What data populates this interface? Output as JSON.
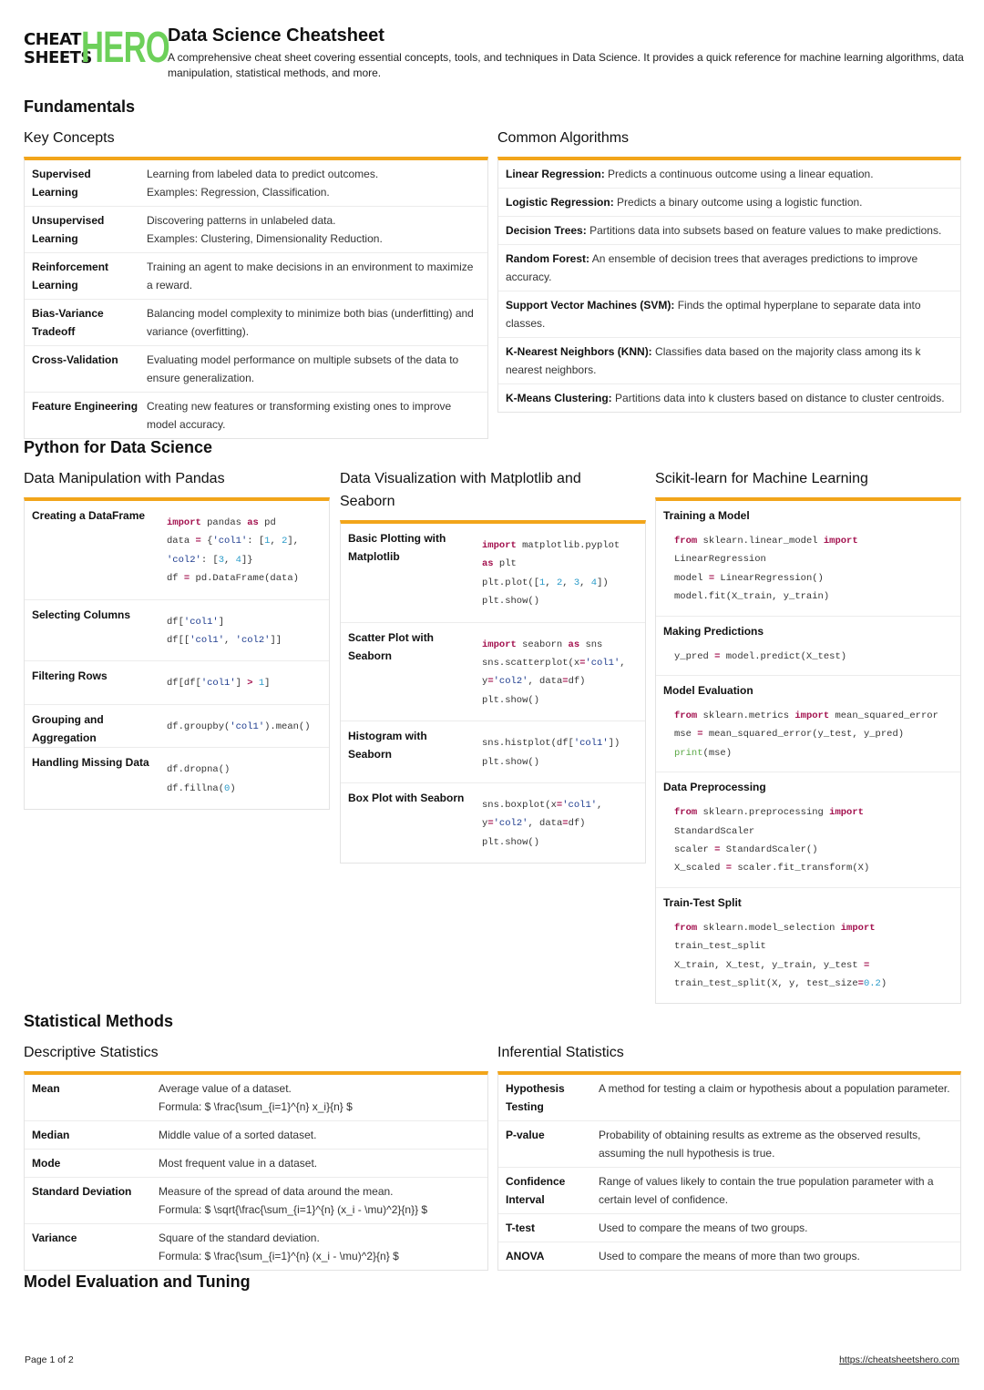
{
  "header": {
    "logo_line1": "CHEAT",
    "logo_line2": "SHEETS",
    "logo_hero": "HERO",
    "title": "Data Science Cheatsheet",
    "subtitle": "A comprehensive cheat sheet covering essential concepts, tools, and techniques in Data Science. It provides a quick reference for machine learning algorithms, data manipulation, statistical methods, and more."
  },
  "colors": {
    "accent": "#f2a51a",
    "logo_green": "#6dd05a",
    "keyword": "#a3124f",
    "string": "#1f3d8f",
    "number": "#2a9bc9"
  },
  "fundamentals": {
    "title": "Fundamentals",
    "key_concepts": {
      "title": "Key Concepts",
      "rows": [
        {
          "term": "Supervised Learning",
          "desc": "Learning from labeled data to predict outcomes.",
          "desc2": "Examples: Regression, Classification."
        },
        {
          "term": "Unsupervised Learning",
          "desc": "Discovering patterns in unlabeled data.",
          "desc2": "Examples: Clustering, Dimensionality Reduction."
        },
        {
          "term": "Reinforcement Learning",
          "desc": "Training an agent to make decisions in an environment to maximize a reward.",
          "desc2": ""
        },
        {
          "term": "Bias-Variance Tradeoff",
          "desc": "Balancing model complexity to minimize both bias (underfitting) and variance (overfitting).",
          "desc2": ""
        },
        {
          "term": "Cross-Validation",
          "desc": "Evaluating model performance on multiple subsets of the data to ensure generalization.",
          "desc2": ""
        },
        {
          "term": "Feature Engineering",
          "desc": "Creating new features or transforming existing ones to improve model accuracy.",
          "desc2": ""
        }
      ]
    },
    "common_algorithms": {
      "title": "Common Algorithms",
      "rows": [
        {
          "name": "Linear Regression:",
          "desc": "Predicts a continuous outcome using a linear equation."
        },
        {
          "name": "Logistic Regression:",
          "desc": "Predicts a binary outcome using a logistic function."
        },
        {
          "name": "Decision Trees:",
          "desc": "Partitions data into subsets based on feature values to make predictions."
        },
        {
          "name": "Random Forest:",
          "desc": "An ensemble of decision trees that averages predictions to improve accuracy."
        },
        {
          "name": "Support Vector Machines (SVM):",
          "desc": "Finds the optimal hyperplane to separate data into classes."
        },
        {
          "name": "K-Nearest Neighbors (KNN):",
          "desc": "Classifies data based on the majority class among its k nearest neighbors."
        },
        {
          "name": "K-Means Clustering:",
          "desc": "Partitions data into k clusters based on distance to cluster centroids."
        }
      ]
    }
  },
  "python": {
    "title": "Python for Data Science",
    "pandas": {
      "title": "Data Manipulation with Pandas",
      "rows": [
        {
          "term": "Creating a DataFrame",
          "code": "import pandas as pd\ndata = {'col1': [1, 2],\n'col2': [3, 4]}\ndf = pd.DataFrame(data)"
        },
        {
          "term": "Selecting Columns",
          "code": "df['col1']\ndf[['col1', 'col2']]"
        },
        {
          "term": "Filtering Rows",
          "code": "df[df['col1'] > 1]"
        },
        {
          "term": "Grouping and Aggregation",
          "code": "df.groupby('col1').mean()"
        },
        {
          "term": "Handling Missing Data",
          "code": "df.dropna()\ndf.fillna(0)"
        }
      ]
    },
    "viz": {
      "title": "Data Visualization with Matplotlib and Seaborn",
      "rows": [
        {
          "term": "Basic Plotting with Matplotlib",
          "code": "import matplotlib.pyplot\nas plt\nplt.plot([1, 2, 3, 4])\nplt.show()"
        },
        {
          "term": "Scatter Plot with Seaborn",
          "code": "import seaborn as sns\nsns.scatterplot(x='col1',\ny='col2', data=df)\nplt.show()"
        },
        {
          "term": "Histogram with Seaborn",
          "code": "sns.histplot(df['col1'])\nplt.show()"
        },
        {
          "term": "Box Plot with Seaborn",
          "code": "sns.boxplot(x='col1',\ny='col2', data=df)\nplt.show()"
        }
      ]
    },
    "sklearn": {
      "title": "Scikit-learn for Machine Learning",
      "rows": [
        {
          "term": "Training a Model",
          "code": "from sklearn.linear_model import\nLinearRegression\nmodel = LinearRegression()\nmodel.fit(X_train, y_train)"
        },
        {
          "term": "Making Predictions",
          "code": "y_pred = model.predict(X_test)"
        },
        {
          "term": "Model Evaluation",
          "code": "from sklearn.metrics import mean_squared_error\nmse = mean_squared_error(y_test, y_pred)\nprint(mse)"
        },
        {
          "term": "Data Preprocessing",
          "code": "from sklearn.preprocessing import\nStandardScaler\nscaler = StandardScaler()\nX_scaled = scaler.fit_transform(X)"
        },
        {
          "term": "Train-Test Split",
          "code": "from sklearn.model_selection import\ntrain_test_split\nX_train, X_test, y_train, y_test =\ntrain_test_split(X, y, test_size=0.2)"
        }
      ]
    }
  },
  "statistics": {
    "title": "Statistical Methods",
    "descriptive": {
      "title": "Descriptive Statistics",
      "rows": [
        {
          "term": "Mean",
          "desc": "Average value of a dataset.",
          "desc2": "Formula: $ \\frac{\\sum_{i=1}^{n} x_i}{n} $"
        },
        {
          "term": "Median",
          "desc": "Middle value of a sorted dataset.",
          "desc2": ""
        },
        {
          "term": "Mode",
          "desc": "Most frequent value in a dataset.",
          "desc2": ""
        },
        {
          "term": "Standard Deviation",
          "desc": "Measure of the spread of data around the mean.",
          "desc2": "Formula: $ \\sqrt{\\frac{\\sum_{i=1}^{n} (x_i - \\mu)^2}{n}} $"
        },
        {
          "term": "Variance",
          "desc": "Square of the standard deviation.",
          "desc2": "Formula: $ \\frac{\\sum_{i=1}^{n} (x_i - \\mu)^2}{n} $"
        }
      ]
    },
    "inferential": {
      "title": "Inferential Statistics",
      "rows": [
        {
          "term": "Hypothesis Testing",
          "desc": "A method for testing a claim or hypothesis about a population parameter."
        },
        {
          "term": "P-value",
          "desc": "Probability of obtaining results as extreme as the observed results, assuming the null hypothesis is true."
        },
        {
          "term": "Confidence Interval",
          "desc": "Range of values likely to contain the true population parameter with a certain level of confidence."
        },
        {
          "term": "T-test",
          "desc": "Used to compare the means of two groups."
        },
        {
          "term": "ANOVA",
          "desc": "Used to compare the means of more than two groups."
        }
      ]
    }
  },
  "model_eval": {
    "title": "Model Evaluation and Tuning"
  },
  "footer": {
    "page": "Page 1 of 2",
    "url": "https://cheatsheetshero.com"
  }
}
